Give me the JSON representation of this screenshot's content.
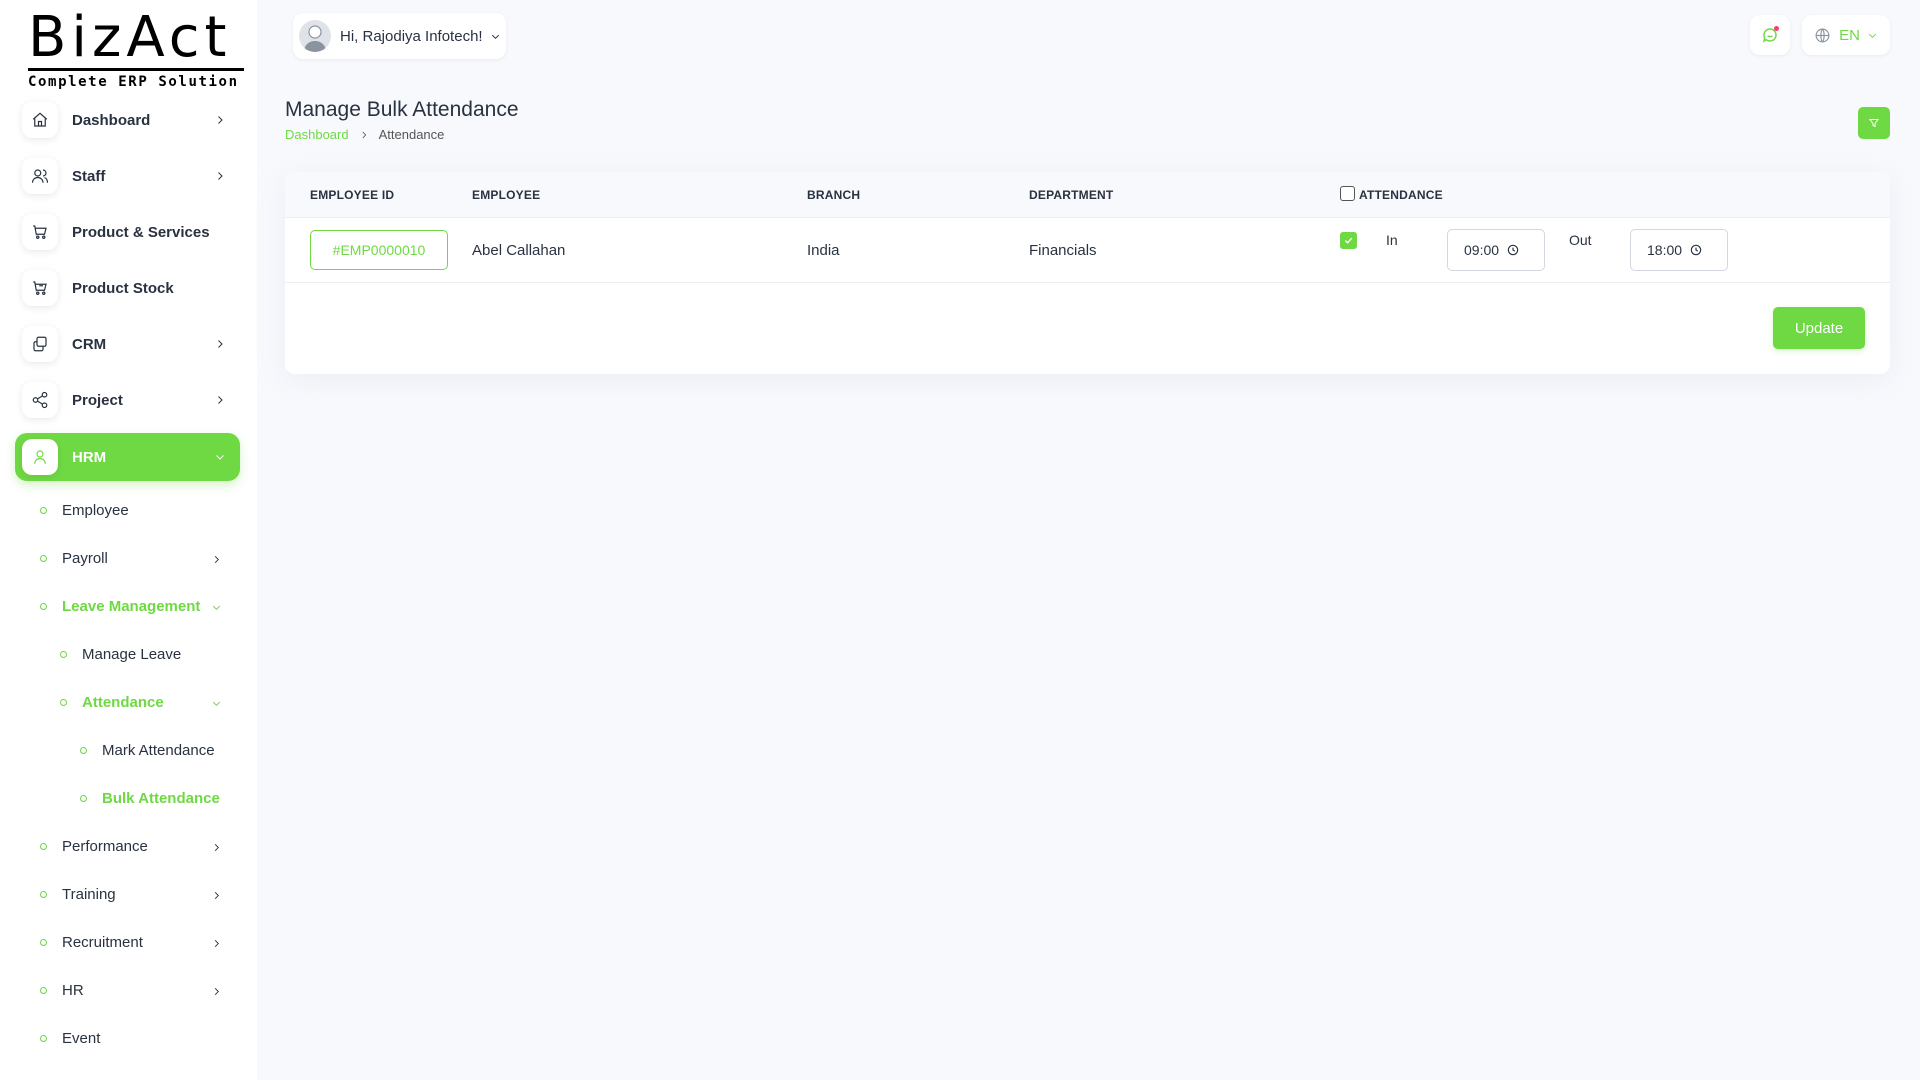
{
  "brand": {
    "logo_text": "BizAct",
    "tagline": "Complete ERP Solution"
  },
  "header": {
    "greeting": "Hi, Rajodiya Infotech!",
    "language": "EN"
  },
  "sidebar": {
    "items": [
      {
        "label": "Dashboard",
        "icon": "home-icon"
      },
      {
        "label": "Staff",
        "icon": "users-icon"
      },
      {
        "label": "Product & Services",
        "icon": "cart-icon"
      },
      {
        "label": "Product Stock",
        "icon": "cart-stock-icon"
      },
      {
        "label": "CRM",
        "icon": "layers-icon"
      },
      {
        "label": "Project",
        "icon": "share-icon"
      },
      {
        "label": "HRM",
        "icon": "user-icon"
      }
    ],
    "hrm_sub": {
      "employee": "Employee",
      "payroll": "Payroll",
      "leave_management": "Leave Management",
      "manage_leave": "Manage Leave",
      "attendance": "Attendance",
      "mark_attendance": "Mark Attendance",
      "bulk_attendance": "Bulk Attendance",
      "performance": "Performance",
      "training": "Training",
      "recruitment": "Recruitment",
      "hr": "HR",
      "event": "Event"
    }
  },
  "page": {
    "title": "Manage Bulk Attendance",
    "breadcrumb": {
      "home": "Dashboard",
      "current": "Attendance"
    }
  },
  "table": {
    "headers": {
      "employee_id": "EMPLOYEE ID",
      "employee": "EMPLOYEE",
      "branch": "BRANCH",
      "department": "DEPARTMENT",
      "attendance": "ATTENDANCE"
    },
    "rows": [
      {
        "employee_id": "#EMP0000010",
        "employee": "Abel Callahan",
        "branch": "India",
        "department": "Financials",
        "in_label": "In",
        "in_time": "09:00",
        "out_label": "Out",
        "out_time": "18:00"
      }
    ]
  },
  "actions": {
    "update_label": "Update"
  },
  "colors": {
    "accent": "#6fd943",
    "text": "#293240",
    "background": "#f8f9fd"
  }
}
